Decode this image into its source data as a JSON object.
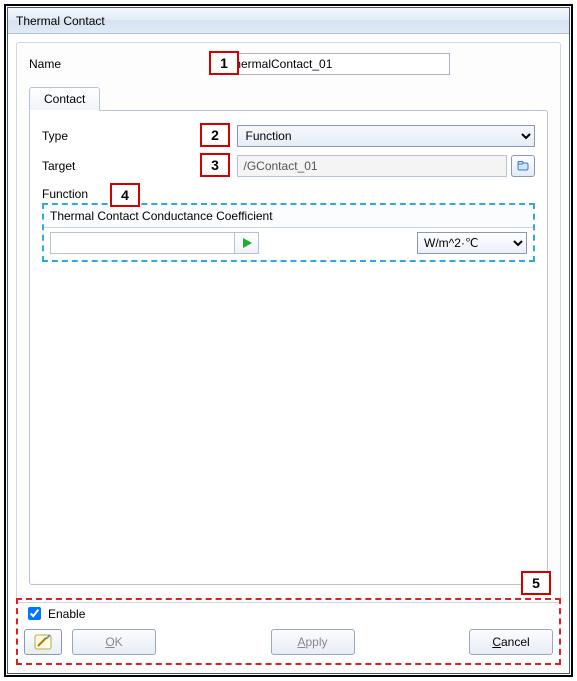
{
  "window": {
    "title": "Thermal Contact"
  },
  "form": {
    "name_label": "Name",
    "name_value": "ThermalContact_01"
  },
  "tabs": {
    "contact": "Contact"
  },
  "contact": {
    "type_label": "Type",
    "type_value": "Function",
    "target_label": "Target",
    "target_value": "/GContact_01",
    "function_label": "Function",
    "coefficient_label": "Thermal Contact Conductance Coefficient",
    "coefficient_value": "",
    "unit_value": "W/m^2·℃"
  },
  "callouts": {
    "c1": "1",
    "c2": "2",
    "c3": "3",
    "c4": "4",
    "c5": "5"
  },
  "footer": {
    "enable_label": "Enable",
    "enable_checked": true,
    "ok": "OK",
    "apply": "Apply",
    "cancel": "Cancel"
  }
}
